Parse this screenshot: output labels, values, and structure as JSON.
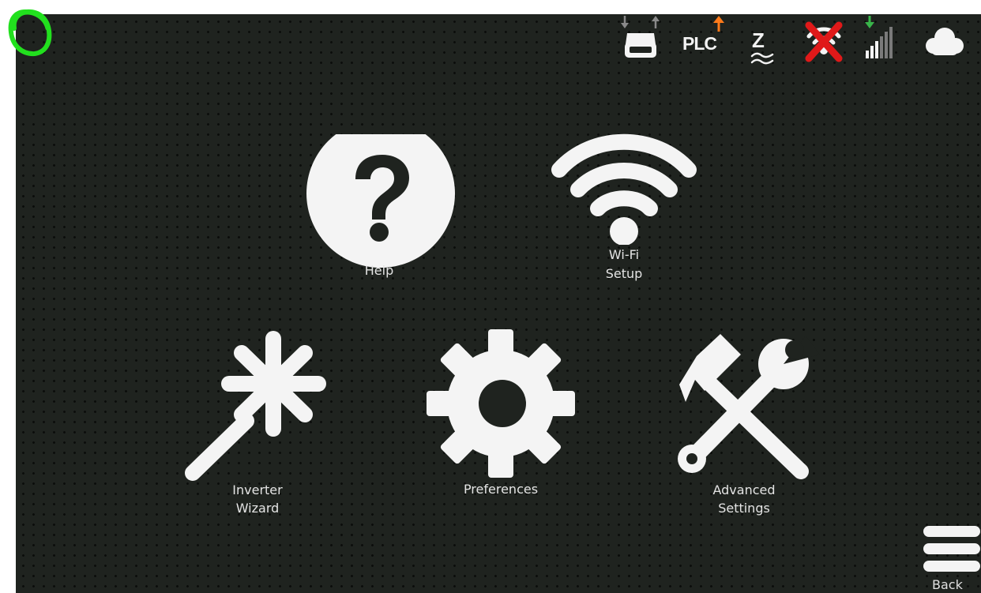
{
  "status_bar": {
    "ethernet_icon": "ethernet-icon",
    "plc_label": "PLC",
    "zigbee_label": "Z",
    "wifi_disconnected_icon": "wifi-disconnected-icon",
    "cellular_icon": "cellular-signal-icon",
    "cloud_icon": "cloud-icon",
    "colors": {
      "up_arrow_active": "#ff7a1a",
      "down_arrow_active": "#39b54a",
      "error_x": "#e01919",
      "inactive": "#8a8a8a"
    }
  },
  "menu": {
    "help": {
      "label": "Help",
      "icon": "help-icon"
    },
    "wifi_setup": {
      "line1": "Wi-Fi",
      "line2": "Setup",
      "icon": "wifi-icon"
    },
    "inverter_wizard": {
      "line1": "Inverter",
      "line2": "Wizard",
      "icon": "magic-wand-icon"
    },
    "preferences": {
      "label": "Preferences",
      "icon": "gear-icon"
    },
    "advanced_settings": {
      "line1": "Advanced",
      "line2": "Settings",
      "icon": "tools-icon"
    }
  },
  "back": {
    "label": "Back",
    "icon": "hamburger-menu-icon"
  },
  "annotation": {
    "icon": "green-circle-annotation",
    "color": "#22e01e"
  }
}
